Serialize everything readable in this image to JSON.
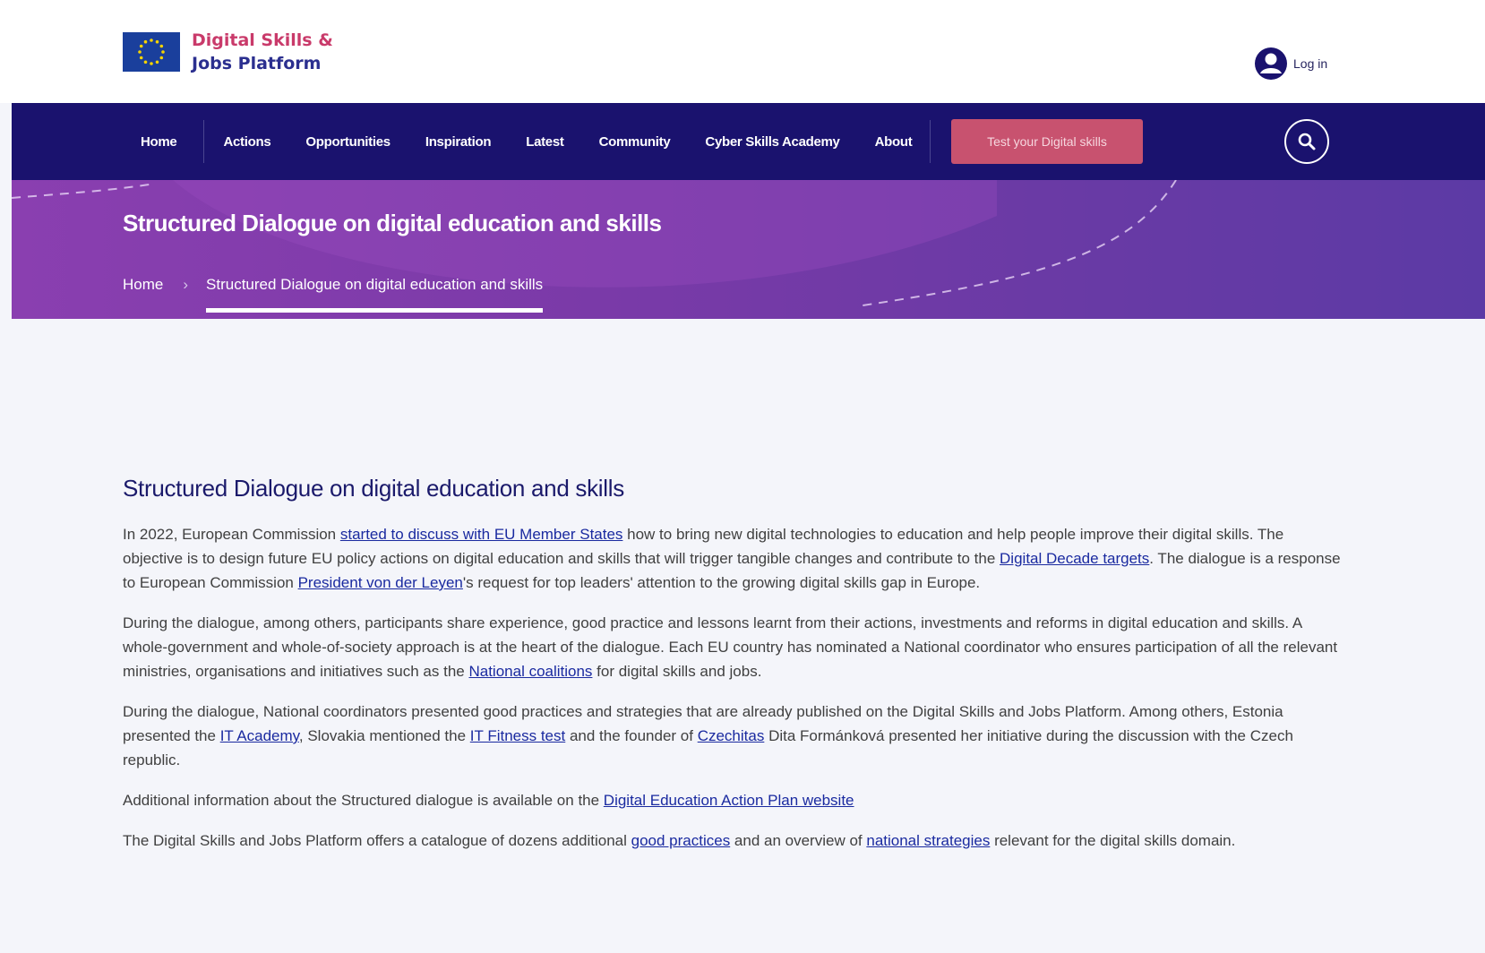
{
  "header": {
    "logo": {
      "line1": "Digital Skills &",
      "line2": "Jobs Platform"
    },
    "login_label": "Log in"
  },
  "nav": {
    "items": [
      "Home",
      "Actions",
      "Opportunities",
      "Inspiration",
      "Latest",
      "Community",
      "Cyber Skills Academy",
      "About"
    ],
    "cta_label": "Test your Digital skills",
    "search_icon": "search-icon"
  },
  "hero": {
    "title": "Structured Dialogue on digital education and skills",
    "breadcrumb": {
      "home": "Home",
      "separator": "›",
      "current": "Structured Dialogue on digital education and skills"
    }
  },
  "article": {
    "heading": "Structured Dialogue on digital education and skills",
    "p1": {
      "t1": "In 2022, European Commission ",
      "l1": "started to discuss with EU Member States",
      "t2": " how to bring new digital technologies to education and help people improve their digital skills. The objective is to design future EU policy actions on digital education and skills that will trigger tangible changes and contribute to the ",
      "l2": "Digital Decade targets",
      "t3": ". The dialogue is a response to European Commission ",
      "l3": "President von der Leyen",
      "t4": "'s request for top leaders' attention to the growing digital skills gap in Europe."
    },
    "p2": {
      "t1": "During the dialogue, among others, participants share experience, good practice and lessons learnt from their actions, investments and reforms in digital education and skills. A whole-government and whole-of-society approach is at the heart of the dialogue. Each EU country has nominated a National coordinator who ensures participation of all the relevant ministries, organisations and initiatives such as the ",
      "l1": "National coalitions",
      "t2": " for digital skills and jobs."
    },
    "p3": {
      "t1": "During the dialogue, National coordinators presented good practices and strategies that are already published on the Digital Skills and Jobs Platform. Among others, Estonia presented the ",
      "l1": "IT Academy",
      "t2": ", Slovakia mentioned the ",
      "l2": "IT Fitness test",
      "t3": " and the founder of ",
      "l3": "Czechitas",
      "t4": " Dita Formánková presented her initiative during the discussion with the Czech republic."
    },
    "p4": {
      "t1": "Additional information about the Structured dialogue is available on the ",
      "l1": "Digital Education Action Plan website"
    },
    "p5": {
      "t1": "The Digital Skills and Jobs Platform offers a catalogue of dozens additional ",
      "l1": "good practices",
      "t2": " and an overview of ",
      "l2": "national strategies",
      "t3": " relevant for the digital skills domain."
    }
  },
  "colors": {
    "nav_bg": "#1a126e",
    "hero_bg": "#7a3aa8",
    "cta_bg": "#c8526f",
    "heading": "#1b1a6b",
    "link": "#1a2aa0",
    "page_bg": "#f4f5fa"
  }
}
